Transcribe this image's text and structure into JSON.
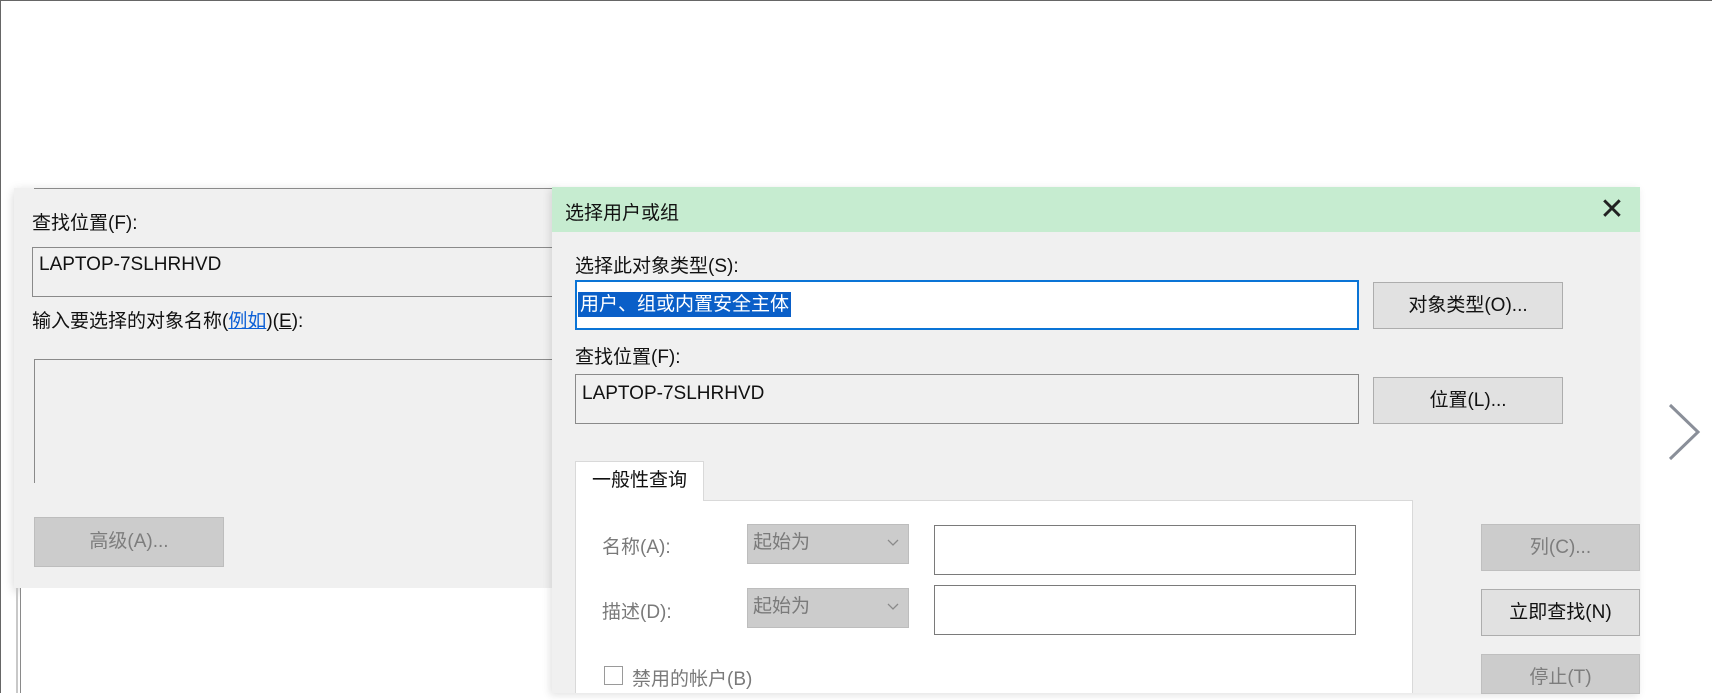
{
  "background_dialog": {
    "location_label": "查找位置(F):",
    "location_value": "LAPTOP-7SLHRHVD",
    "enter_names_label_pre": "输入要选择的对象名称(",
    "enter_names_link": "例如",
    "enter_names_label_post": ")(",
    "enter_names_mnemonic": "E",
    "enter_names_label_end": "):",
    "advanced_button": "高级(A)..."
  },
  "dialog": {
    "title": "选择用户或组",
    "close_glyph": "✕",
    "object_type_label": "选择此对象类型(S):",
    "object_type_value": "用户、组或内置安全主体",
    "object_types_button": "对象类型(O)...",
    "location_label": "查找位置(F):",
    "location_value": "LAPTOP-7SLHRHVD",
    "locations_button": "位置(L)...",
    "tab_general": "一般性查询",
    "name_label": "名称(A):",
    "name_combo": "起始为",
    "desc_label": "描述(D):",
    "desc_combo": "起始为",
    "disabled_accounts_label": "禁用的帐户(B)",
    "columns_button": "列(C)...",
    "find_now_button": "立即查找(N)",
    "stop_button": "停止(T)"
  },
  "icons": {
    "close": "close-icon",
    "dropdown": "chevron-down-icon",
    "next": "chevron-right-icon"
  },
  "colors": {
    "titlebar": "#c6ecd0",
    "selection": "#0a5fc8",
    "focus_border": "#0a74d6",
    "link": "#0b5fd7"
  }
}
